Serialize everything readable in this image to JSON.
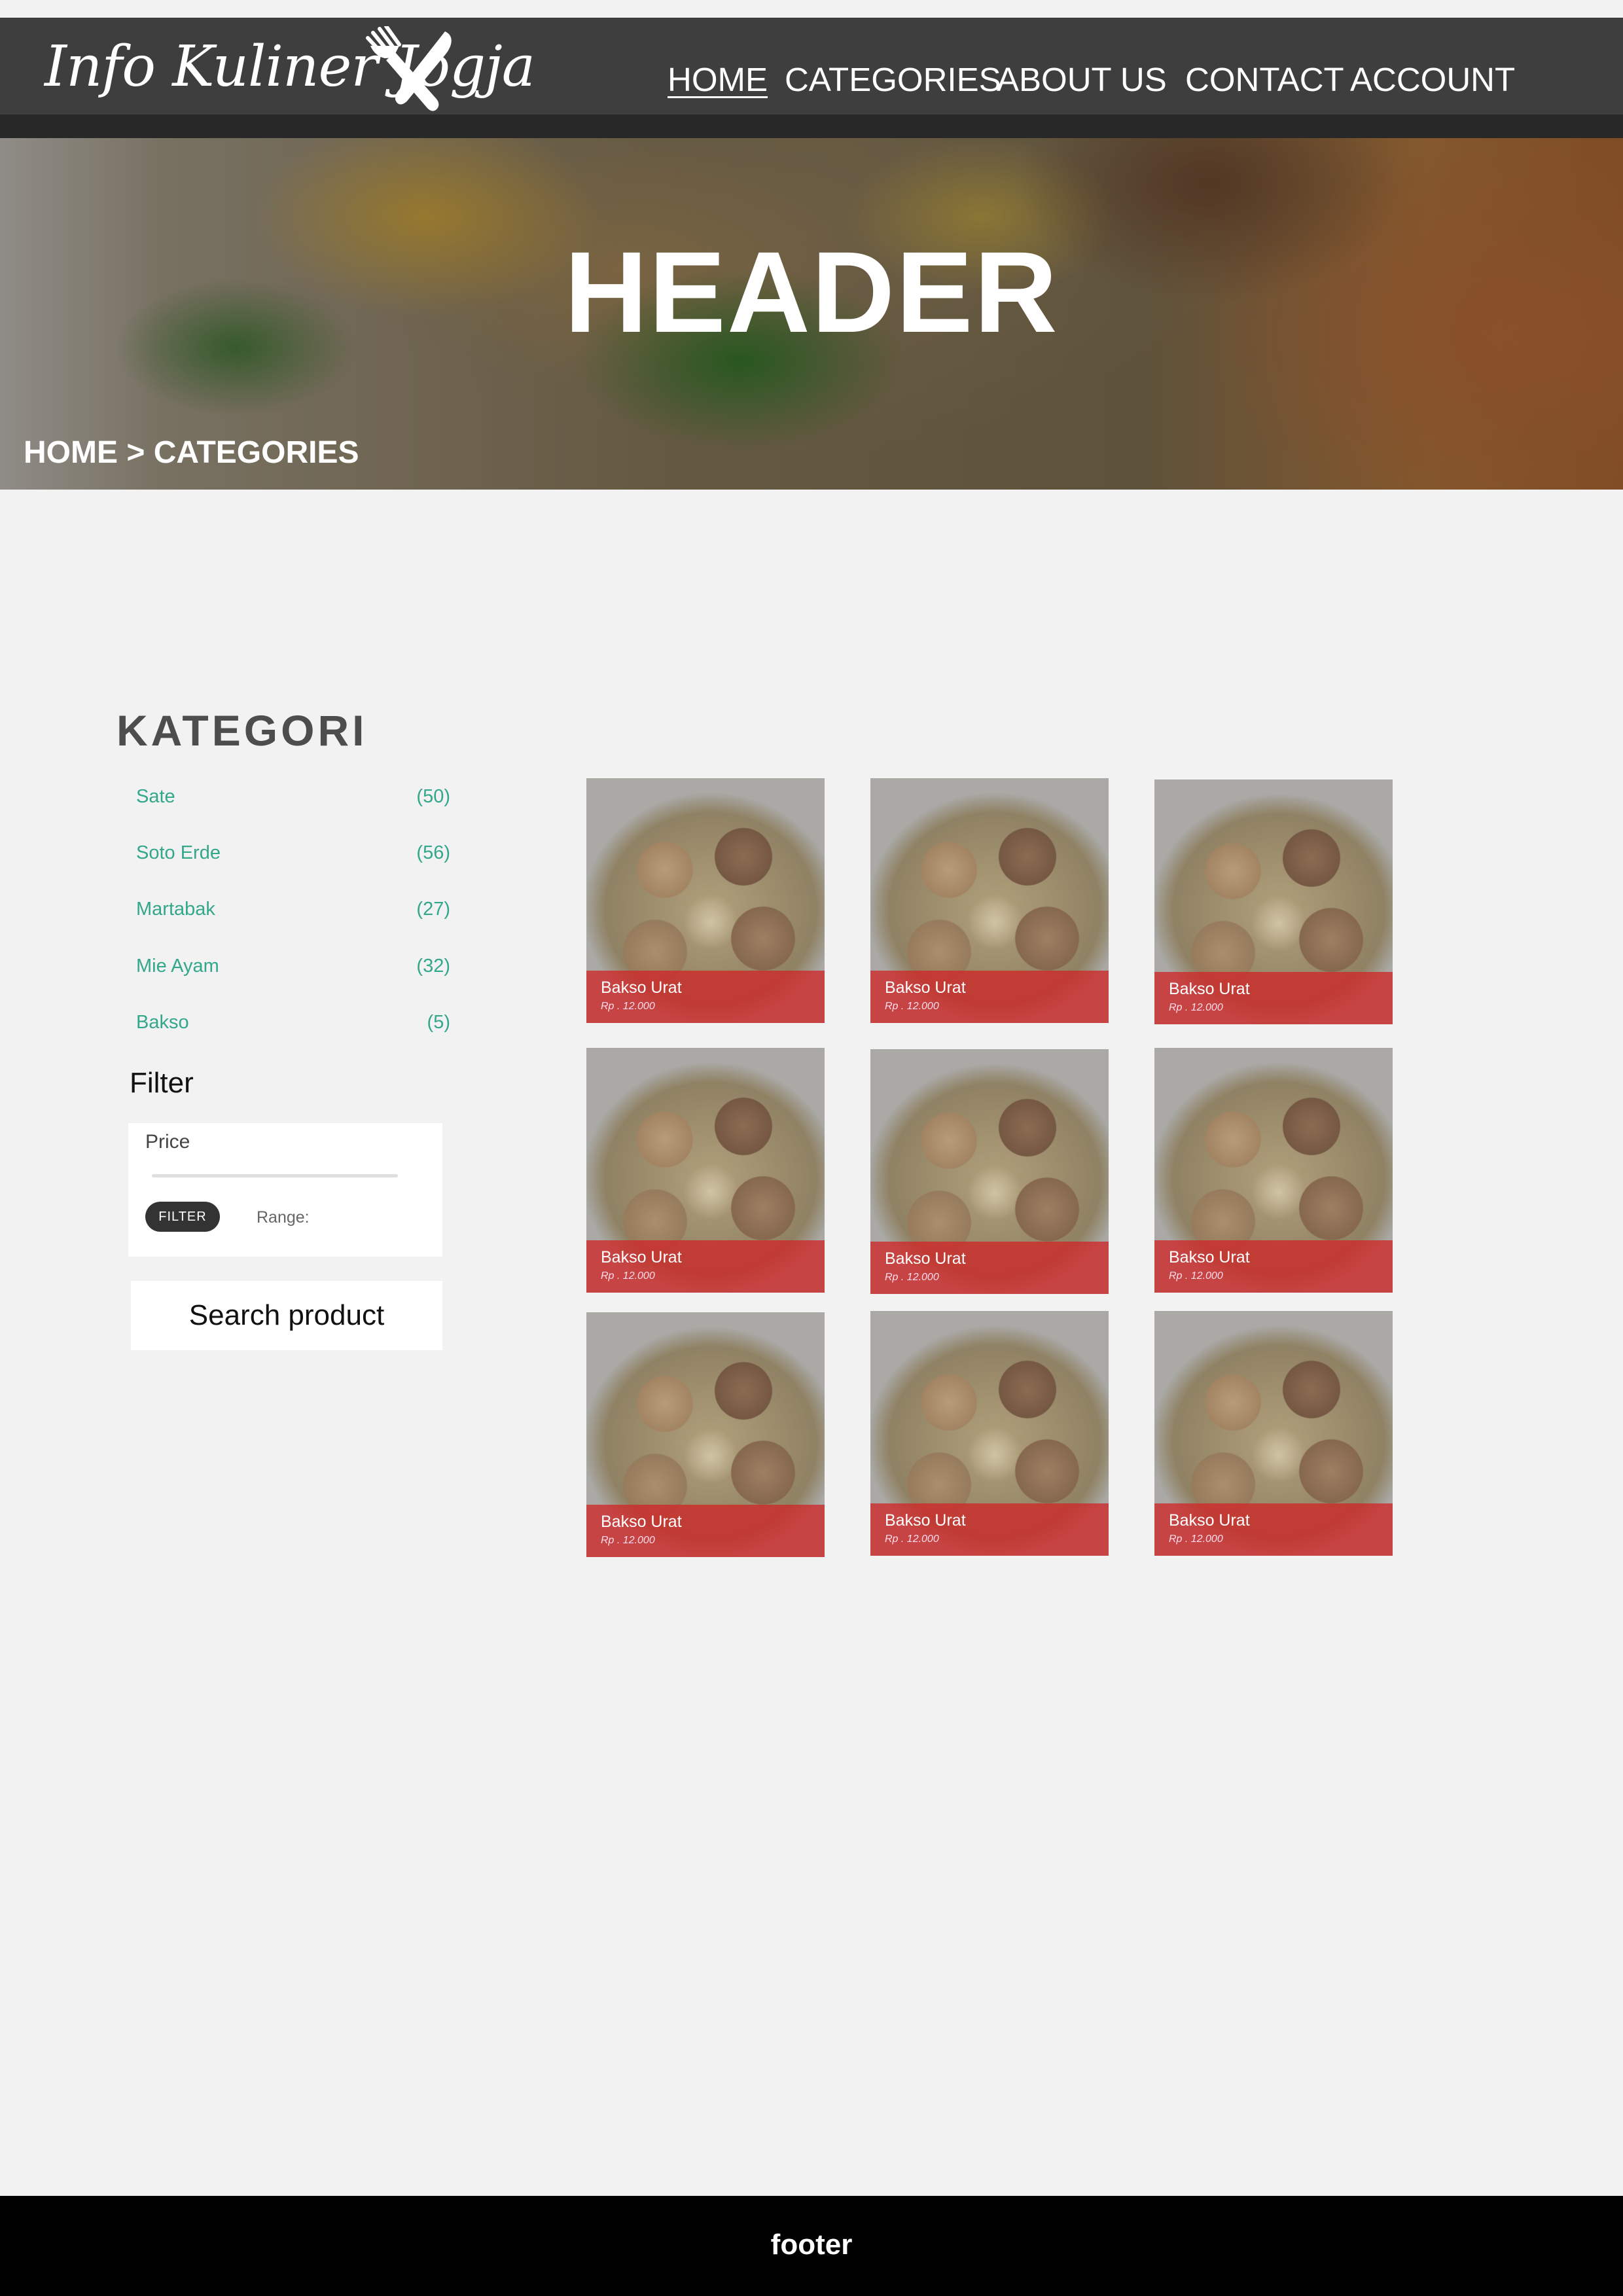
{
  "brand": {
    "name": "Info Kuliner Jogja",
    "icon": "fork-knife-icon"
  },
  "nav": {
    "items": [
      {
        "label": "HOME",
        "active": true
      },
      {
        "label": "CATEGORIES"
      },
      {
        "label": "ABOUT US"
      },
      {
        "label": "CONTACT"
      },
      {
        "label": "ACCOUNT"
      }
    ]
  },
  "hero": {
    "title": "HEADER",
    "breadcrumb": "HOME > CATEGORIES"
  },
  "sidebar": {
    "title": "KATEGORI",
    "categories": [
      {
        "name": "Sate",
        "count": "(50)"
      },
      {
        "name": "Soto Erde",
        "count": "(56)"
      },
      {
        "name": "Martabak",
        "count": "(27)"
      },
      {
        "name": "Mie Ayam",
        "count": "(32)"
      },
      {
        "name": "Bakso",
        "count": "(5)"
      }
    ],
    "filter": {
      "title": "Filter",
      "price_label": "Price",
      "button_label": "FILTER",
      "range_label": "Range:"
    },
    "search_button": "Search product"
  },
  "products": [
    {
      "name": "Bakso Urat",
      "price": "Rp . 12.000"
    },
    {
      "name": "Bakso Urat",
      "price": "Rp . 12.000"
    },
    {
      "name": "Bakso Urat",
      "price": "Rp . 12.000"
    },
    {
      "name": "Bakso Urat",
      "price": "Rp . 12.000"
    },
    {
      "name": "Bakso Urat",
      "price": "Rp . 12.000"
    },
    {
      "name": "Bakso Urat",
      "price": "Rp . 12.000"
    },
    {
      "name": "Bakso Urat",
      "price": "Rp . 12.000"
    },
    {
      "name": "Bakso Urat",
      "price": "Rp . 12.000"
    },
    {
      "name": "Bakso Urat",
      "price": "Rp . 12.000"
    }
  ],
  "footer": {
    "text": "footer"
  },
  "colors": {
    "nav": "#3e3e3e",
    "accent": "#33a78a",
    "card_band": "#ce2828",
    "footer": "#000000"
  }
}
